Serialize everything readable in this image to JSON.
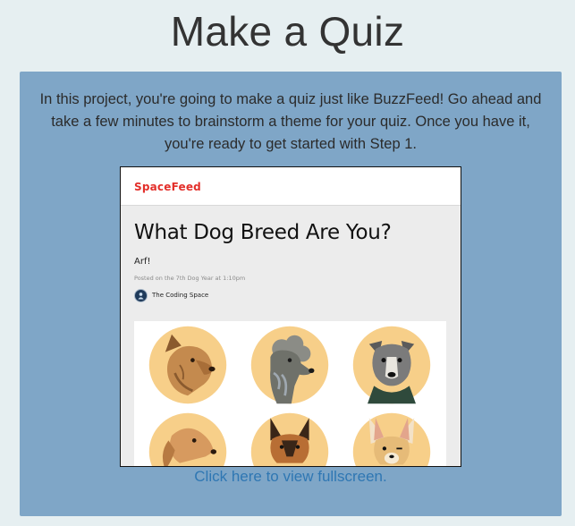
{
  "page": {
    "title": "Make a Quiz"
  },
  "panel": {
    "intro": "In this project, you're going to make a quiz just like BuzzFeed! Go ahead and take a few minutes to brainstorm a theme for your quiz. Once you have it, you're ready to get started with Step 1.",
    "link_text": "Click here to view fullscreen."
  },
  "preview": {
    "logo": "SpaceFeed",
    "quiz_title": "What Dog Breed Are You?",
    "subtitle": "Arf!",
    "meta": "Posted on the 7th Dog Year at 1:10pm",
    "author": "The Coding Space",
    "dogs": [
      "terrier",
      "poodle",
      "pit-bull",
      "golden-retriever",
      "german-shepherd",
      "chihuahua"
    ]
  },
  "colors": {
    "page_bg": "#e6eff1",
    "panel_bg": "#7fa6c7",
    "link": "#2f77b3",
    "logo": "#e3302b",
    "dog_circle": "#f7cf89"
  }
}
